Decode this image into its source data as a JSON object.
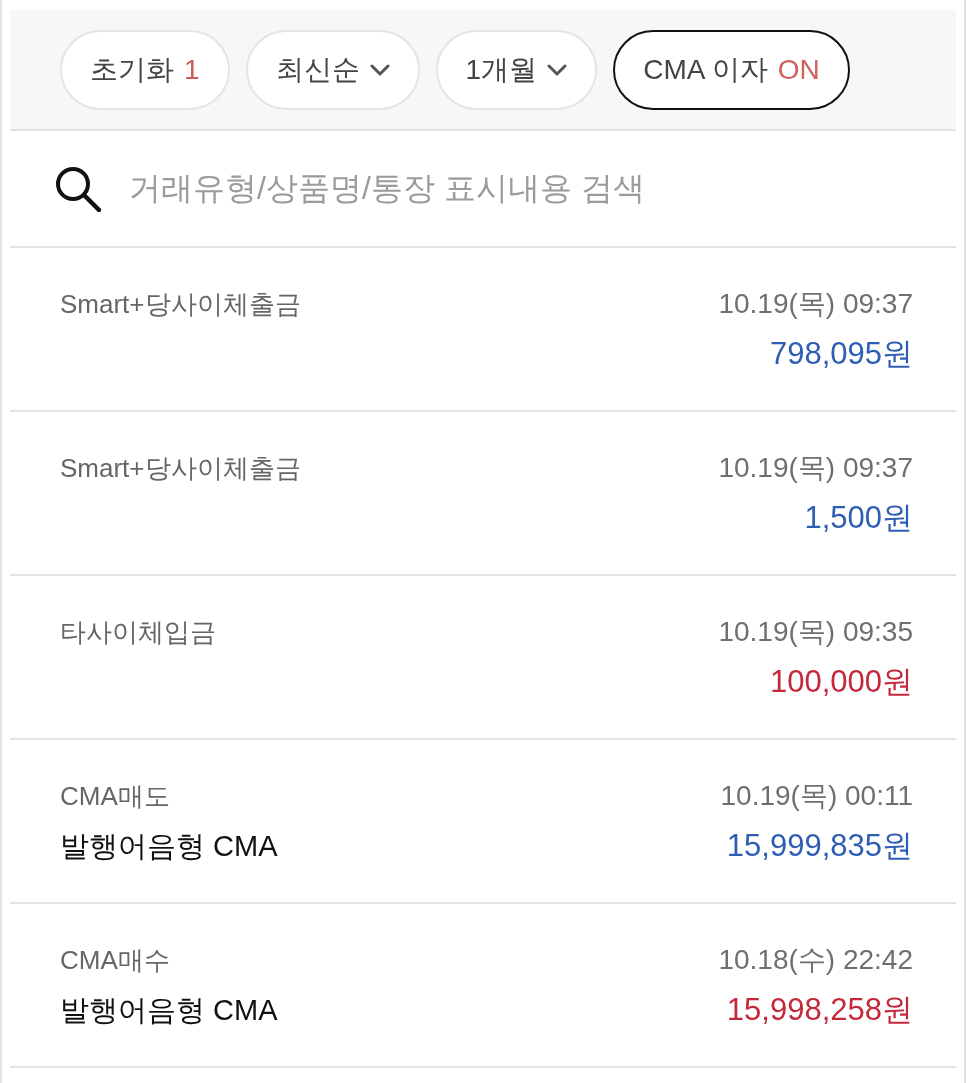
{
  "filters": [
    {
      "kind": "reset",
      "label": "초기화",
      "count": "1"
    },
    {
      "kind": "dropdown",
      "label": "최신순"
    },
    {
      "kind": "dropdown",
      "label": "1개월"
    },
    {
      "kind": "toggle",
      "label": "CMA 이자",
      "value": "ON",
      "on": true
    }
  ],
  "search": {
    "placeholder": "거래유형/상품명/통장 표시내용 검색"
  },
  "transactions": [
    {
      "type": "Smart+당사이체출금",
      "datetime": "10.19(목) 09:37",
      "amount": "798,095원",
      "color": "#2e5eb4"
    },
    {
      "type": "Smart+당사이체출금",
      "datetime": "10.19(목) 09:37",
      "amount": "1,500원",
      "color": "#2e5eb4"
    },
    {
      "type": "타사이체입금",
      "datetime": "10.19(목) 09:35",
      "amount": "100,000원",
      "color": "#c4283b"
    },
    {
      "type": "CMA매도",
      "product": "발행어음형 CMA",
      "datetime": "10.19(목) 00:11",
      "amount": "15,999,835원",
      "color": "#2e5eb4"
    },
    {
      "type": "CMA매수",
      "product": "발행어음형 CMA",
      "datetime": "10.18(수) 22:42",
      "amount": "15,998,258원",
      "color": "#c4283b"
    }
  ]
}
